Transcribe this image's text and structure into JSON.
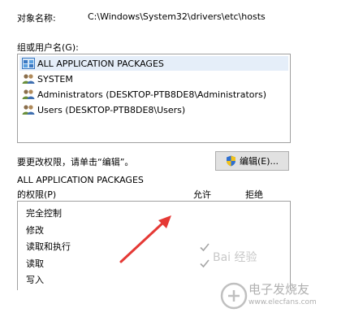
{
  "object": {
    "label": "对象名称:",
    "value": "C:\\Windows\\System32\\drivers\\etc\\hosts"
  },
  "groups": {
    "label": "组或用户名(G):",
    "items": [
      {
        "name": "ALL APPLICATION PACKAGES",
        "icon": "app-packages-icon",
        "selected": true
      },
      {
        "name": "SYSTEM",
        "icon": "users-icon",
        "selected": false
      },
      {
        "name": "Administrators (DESKTOP-PTB8DE8\\Administrators)",
        "icon": "users-icon",
        "selected": false
      },
      {
        "name": "Users (DESKTOP-PTB8DE8\\Users)",
        "icon": "users-icon",
        "selected": false
      }
    ]
  },
  "change_hint": "要更改权限，请单击“编辑”。",
  "edit_button": {
    "label": "编辑(E)...",
    "icon": "uac-shield-icon"
  },
  "permissions": {
    "for_name": "ALL APPLICATION PACKAGES",
    "title": "的权限(P)",
    "col_allow": "允许",
    "col_deny": "拒绝",
    "rows": [
      {
        "name": "完全控制",
        "allow": false,
        "deny": false
      },
      {
        "name": "修改",
        "allow": false,
        "deny": false
      },
      {
        "name": "读取和执行",
        "allow": true,
        "deny": false
      },
      {
        "name": "读取",
        "allow": true,
        "deny": false
      },
      {
        "name": "写入",
        "allow": false,
        "deny": false
      }
    ]
  },
  "annotation": {
    "arrow_color": "#e53935"
  },
  "watermark": {
    "text": "Bai 经验"
  },
  "site_logo": {
    "text": "电子发烧友",
    "url": "www.elecfans.com"
  }
}
